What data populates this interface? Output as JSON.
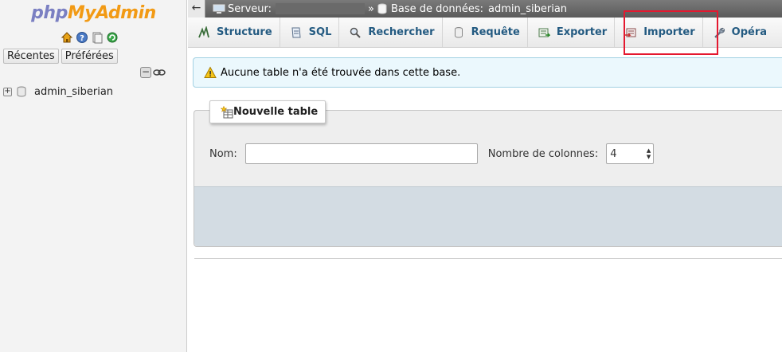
{
  "logo": {
    "part1": "php",
    "part2": "MyAdmin"
  },
  "nav": {
    "quick_icons": [
      "home-icon",
      "help-icon",
      "docs-icon",
      "reload-icon"
    ],
    "tabs": [
      "Récentes",
      "Préférées"
    ],
    "databases": [
      {
        "name": "admin_siberian"
      }
    ]
  },
  "breadcrumb": {
    "server_label": "Serveur:",
    "server_value": "",
    "separator": "»",
    "database_label": "Base de données:",
    "database_value": "admin_siberian"
  },
  "menu": [
    {
      "label": "Structure",
      "icon": "structure-icon"
    },
    {
      "label": "SQL",
      "icon": "sql-icon"
    },
    {
      "label": "Rechercher",
      "icon": "search-icon"
    },
    {
      "label": "Requête",
      "icon": "query-icon"
    },
    {
      "label": "Exporter",
      "icon": "export-icon"
    },
    {
      "label": "Importer",
      "icon": "import-icon"
    },
    {
      "label": "Opéra",
      "icon": "wrench-icon"
    }
  ],
  "notice": {
    "text": "Aucune table n'a été trouvée dans cette base."
  },
  "new_table": {
    "legend": "Nouvelle table",
    "name_label": "Nom:",
    "name_value": "",
    "columns_label": "Nombre de colonnes:",
    "columns_value": "4"
  },
  "colors": {
    "link": "#235a81",
    "highlight_box": "#e4182f",
    "notice_bg": "#ebf8fd",
    "logo_php": "#7a7fc2",
    "logo_myadmin": "#f29a14"
  }
}
